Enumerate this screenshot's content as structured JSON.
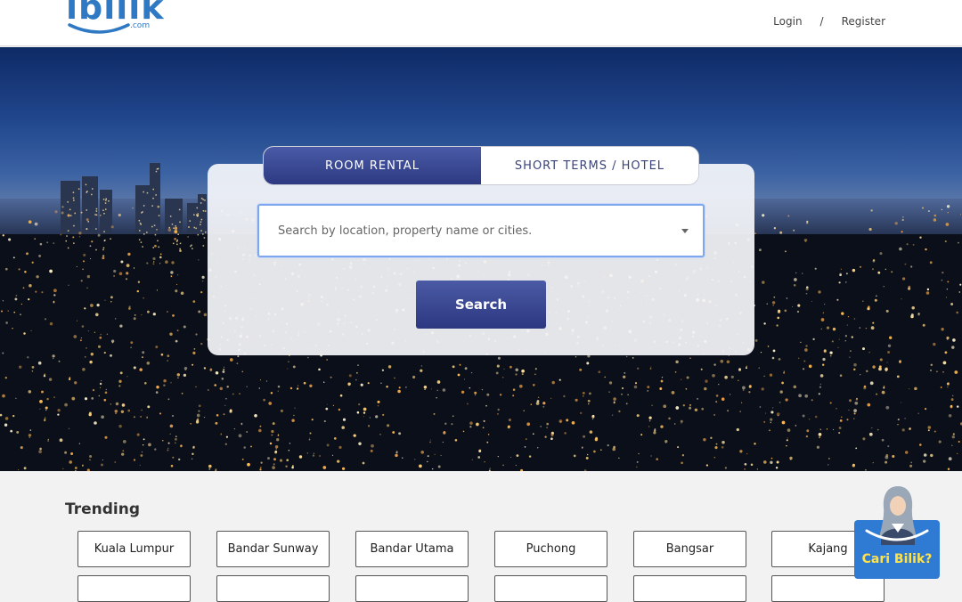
{
  "brand": {
    "logo_text": "ibilik",
    "logo_suffix": ".com",
    "color": "#2f78c4"
  },
  "auth": {
    "login": "Login",
    "separator": "/",
    "register": "Register"
  },
  "search": {
    "tabs": [
      {
        "label": "ROOM RENTAL",
        "active": true
      },
      {
        "label": "SHORT TERMS / HOTEL",
        "active": false
      }
    ],
    "placeholder": "Search by location, property name or cities.",
    "button_label": "Search"
  },
  "trending": {
    "title": "Trending",
    "items": [
      "Kuala Lumpur",
      "Bandar Sunway",
      "Bandar Utama",
      "Puchong",
      "Bangsar",
      "Kajang"
    ]
  },
  "chat_widget": {
    "label": "Cari Bilik?"
  },
  "colors": {
    "accent": "#2d3a82",
    "focus_border": "#7fa7ee",
    "widget_bg": "#2f7bd3",
    "widget_text": "#ffe24a"
  }
}
